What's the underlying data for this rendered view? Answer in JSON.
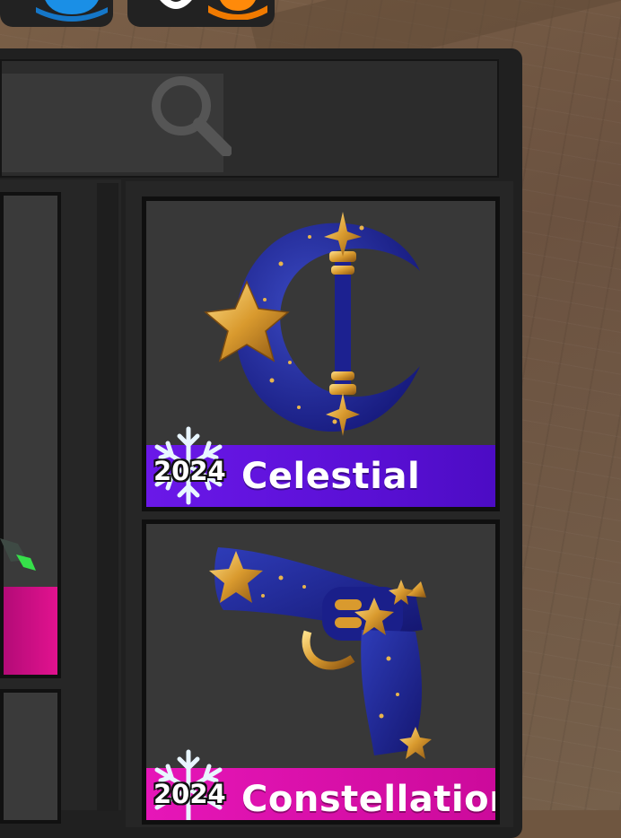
{
  "items": [
    {
      "name": "Celestial",
      "year": "2024",
      "icon": "moon-scythe-icon",
      "color": "#6a18e8"
    },
    {
      "name": "Constellation",
      "year": "2024",
      "icon": "star-revolver-icon",
      "color": "#e616b8"
    }
  ],
  "search": {
    "placeholder": ""
  },
  "colors": {
    "panel": "#202020",
    "rare_purple": "#6a18e8",
    "rare_pink": "#e616b8"
  }
}
